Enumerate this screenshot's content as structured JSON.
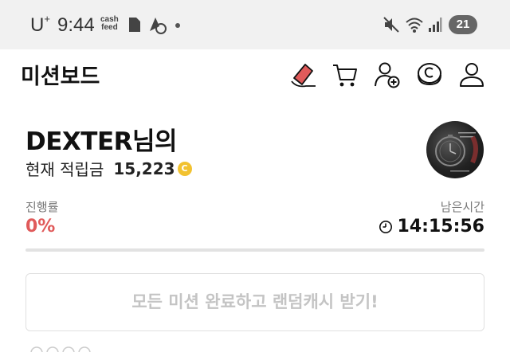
{
  "status_bar": {
    "carrier": "U",
    "carrier_sup": "+",
    "time": "9:44",
    "cashfeed_line1": "cash",
    "cashfeed_line2": "feed",
    "battery": "21"
  },
  "appbar": {
    "title": "미션보드"
  },
  "user": {
    "greeting": "DEXTER님의",
    "points_label": "현재 적립금",
    "points_value": "15,223",
    "coin_symbol": "C"
  },
  "progress": {
    "label": "진행률",
    "value_text": "0%",
    "fraction": 0
  },
  "timer": {
    "label": "남은시간",
    "value": "14:15:56"
  },
  "reward_button": {
    "label": "모든 미션 완료하고 랜덤캐시 받기!"
  },
  "colors": {
    "accent_red": "#e05a5a",
    "coin_gold": "#f2c230",
    "disabled_text": "#c4c4c4"
  },
  "icons": [
    "ticket-icon",
    "cart-icon",
    "add-friend-icon",
    "coin-icon",
    "profile-icon"
  ]
}
